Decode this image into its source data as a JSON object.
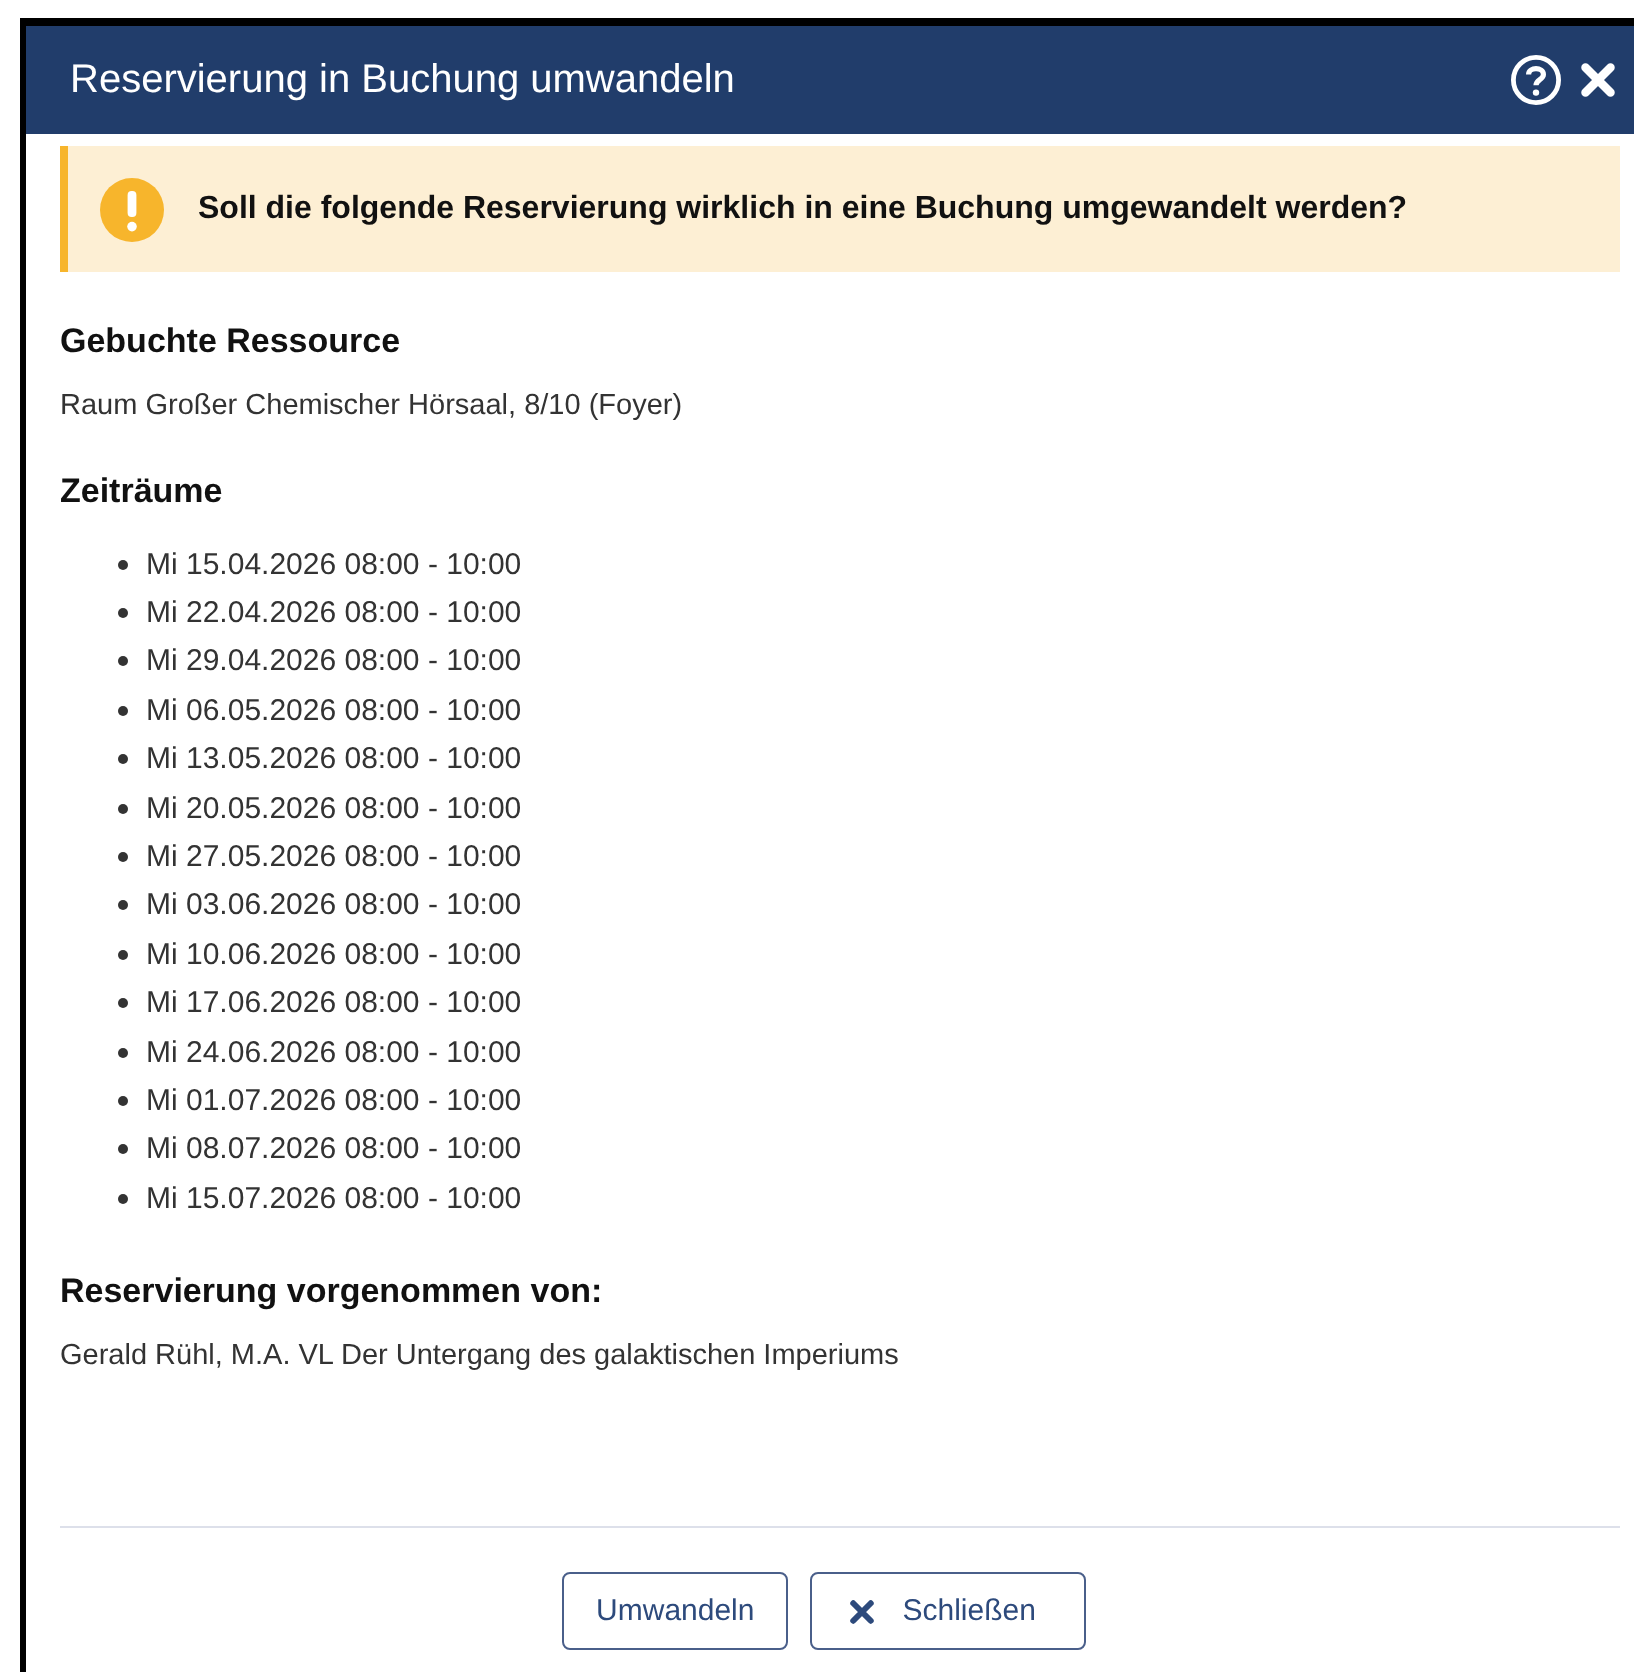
{
  "window": {
    "title": "Reservierung in Buchung umwandeln"
  },
  "warning": {
    "text": "Soll die folgende Reservierung wirklich in eine Buchung umgewandelt werden?"
  },
  "sections": [
    {
      "kind": "text",
      "heading": "Gebuchte Ressource",
      "text": "Raum Großer Chemischer Hörsaal, 8/10 (Foyer)"
    },
    {
      "kind": "list",
      "heading": "Zeiträume",
      "items": [
        "Mi 15.04.2026 08:00 - 10:00",
        "Mi 22.04.2026 08:00 - 10:00",
        "Mi 29.04.2026 08:00 - 10:00",
        "Mi 06.05.2026 08:00 - 10:00",
        "Mi 13.05.2026 08:00 - 10:00",
        "Mi 20.05.2026 08:00 - 10:00",
        "Mi 27.05.2026 08:00 - 10:00",
        "Mi 03.06.2026 08:00 - 10:00",
        "Mi 10.06.2026 08:00 - 10:00",
        "Mi 17.06.2026 08:00 - 10:00",
        "Mi 24.06.2026 08:00 - 10:00",
        "Mi 01.07.2026 08:00 - 10:00",
        "Mi 08.07.2026 08:00 - 10:00",
        "Mi 15.07.2026 08:00 - 10:00"
      ]
    },
    {
      "kind": "text",
      "heading": "Reservierung vorgenommen von:",
      "text": "Gerald Rühl, M.A. VL Der Untergang des galaktischen Imperiums"
    }
  ],
  "buttons": [
    {
      "label": "Umwandeln",
      "kind": "plain"
    },
    {
      "label": "Schließen",
      "kind": "close"
    }
  ]
}
